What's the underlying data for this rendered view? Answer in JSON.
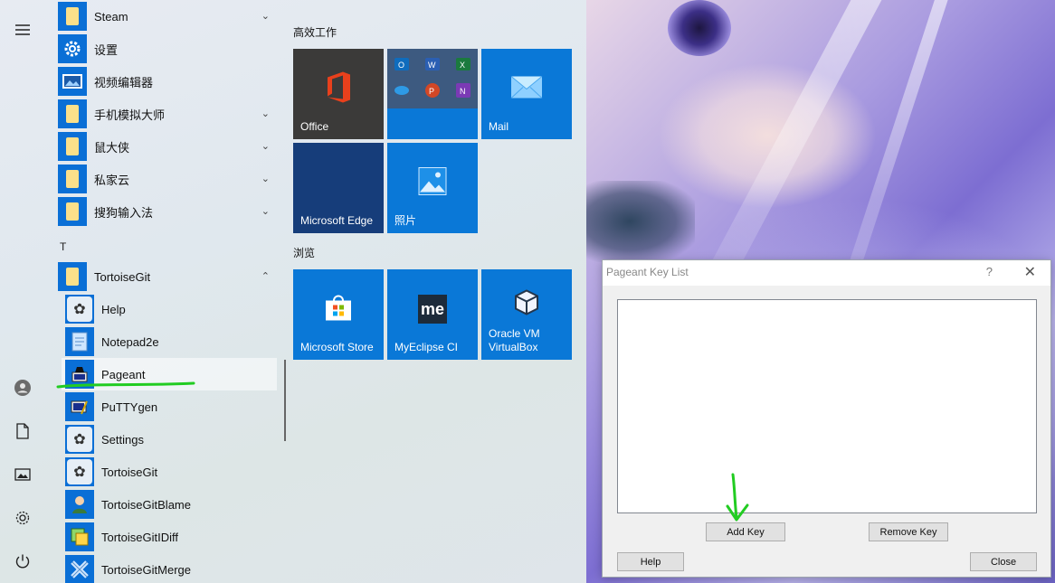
{
  "start_menu": {
    "rail": {
      "icons": [
        "hamburger-menu-icon",
        "user-icon",
        "document-icon",
        "pictures-icon",
        "settings-icon",
        "power-icon"
      ]
    },
    "apps": [
      {
        "label": "Steam",
        "type": "folder",
        "expandable": true
      },
      {
        "label": "设置",
        "type": "app",
        "icon": "gear-icon"
      },
      {
        "label": "视频编辑器",
        "type": "app",
        "icon": "video-editor-icon"
      },
      {
        "label": "手机模拟大师",
        "type": "folder",
        "expandable": true
      },
      {
        "label": "鼠大侠",
        "type": "folder",
        "expandable": true
      },
      {
        "label": "私家云",
        "type": "folder",
        "expandable": true
      },
      {
        "label": "搜狗输入法",
        "type": "folder",
        "expandable": true
      }
    ],
    "section_letter": "T",
    "tortoise_folder": "TortoiseGit",
    "tortoise_items": [
      "Help",
      "Notepad2e",
      "Pageant",
      "PuTTYgen",
      "Settings",
      "TortoiseGit",
      "TortoiseGitBlame",
      "TortoiseGitIDiff",
      "TortoiseGitMerge"
    ],
    "tile_groups": [
      {
        "title": "高效工作",
        "tiles": [
          {
            "name": "Office",
            "icon": "office-icon",
            "color": "#3b3a39"
          },
          {
            "name": "",
            "icon": "office-apps-icon",
            "color": "#0a78d7"
          },
          {
            "name": "Mail",
            "icon": "mail-icon",
            "color": "#0a78d7"
          },
          {
            "name": "Microsoft Edge",
            "icon": "edge-icon",
            "color": "#163d7a"
          },
          {
            "name": "照片",
            "icon": "photos-icon",
            "color": "#0a78d7"
          }
        ]
      },
      {
        "title": "浏览",
        "tiles": [
          {
            "name": "Microsoft Store",
            "icon": "store-icon",
            "color": "#0a78d7"
          },
          {
            "name": "MyEclipse CI",
            "icon": "myeclipse-icon",
            "color": "#0a78d7"
          },
          {
            "name": "Oracle VM VirtualBox",
            "icon": "virtualbox-icon",
            "color": "#0a78d7"
          }
        ]
      }
    ],
    "myeclipse_logo": "me"
  },
  "dialog": {
    "title": "Pageant Key List",
    "help_glyph": "?",
    "close_glyph": "✕",
    "add_key": "Add Key",
    "remove_key": "Remove Key",
    "help": "Help",
    "close": "Close"
  },
  "annotation_color": "#22cc22"
}
